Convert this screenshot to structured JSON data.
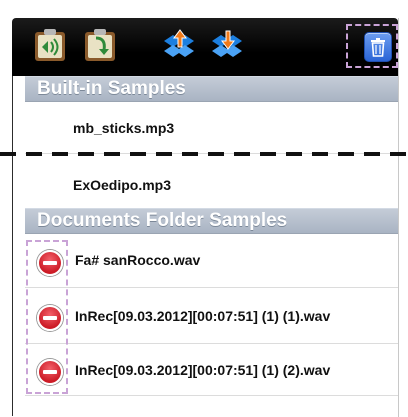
{
  "toolbar": {
    "icons": [
      "add-sample-icon",
      "import-sample-icon",
      "dropbox-upload-icon",
      "dropbox-download-icon",
      "trash-icon"
    ],
    "accent": "#2a64d6"
  },
  "sections": {
    "built_in": {
      "title": "Built-in Samples",
      "items": [
        {
          "label": "mb_sticks.mp3"
        },
        {
          "label": "ExOedipo.mp3"
        }
      ]
    },
    "documents": {
      "title": "Documents Folder Samples",
      "items": [
        {
          "label": "Fa# sanRocco.wav"
        },
        {
          "label": "InRec[09.03.2012][00:07:51] (1) (1).wav"
        },
        {
          "label": "InRec[09.03.2012][00:07:51] (1) (2).wav"
        }
      ]
    }
  },
  "colors": {
    "header_bg": "#aab5c4",
    "delete_red": "#cc1b26",
    "highlight": "#c9a3d6"
  }
}
